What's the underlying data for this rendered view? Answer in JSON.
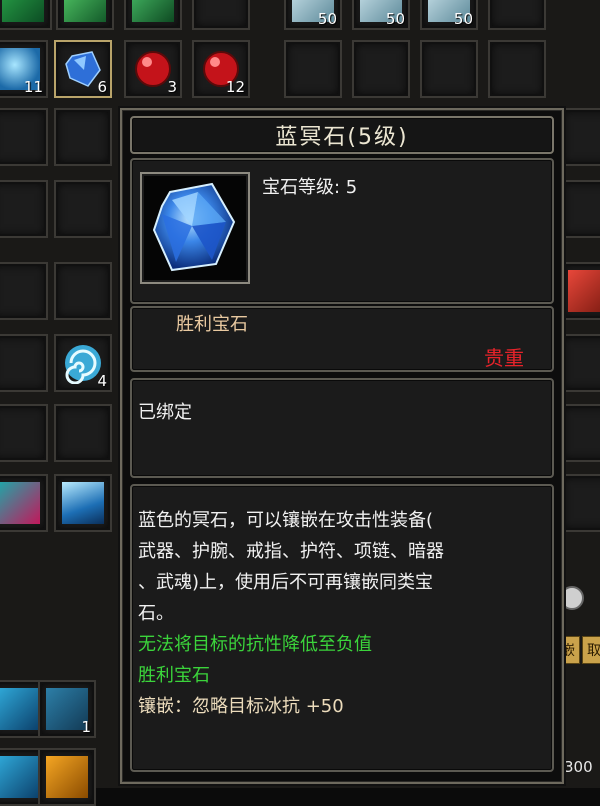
{
  "inventory": {
    "slot_counts": {
      "r0c4": "50",
      "r0c5": "50",
      "r0c6": "50",
      "r1c0": "11",
      "r1c1": "6",
      "r1c2": "3",
      "r1c3": "12",
      "r5c1": "4",
      "r9c1": "1",
      "r10c8": "300"
    },
    "edge_buttons": {
      "a": "嵌",
      "b": "取"
    }
  },
  "tooltip": {
    "title": "蓝冥石(5级)",
    "level_label": "宝石等级: 5",
    "category": "胜利宝石",
    "rarity": "贵重",
    "rarity_color": "#e6232a",
    "binding": "已绑定",
    "description_lines": [
      "蓝色的冥石，可以镶嵌在攻击性装备(",
      "武器、护腕、戒指、护符、项链、暗器",
      "、武魂)上，使用后不可再镶嵌同类宝",
      "石。"
    ],
    "effect_note": "无法将目标的抗性降低至负值",
    "effect_category": "胜利宝石",
    "inlay_stat": "镶嵌：忽略目标冰抗  +50",
    "effect_color": "#3bd43b"
  }
}
